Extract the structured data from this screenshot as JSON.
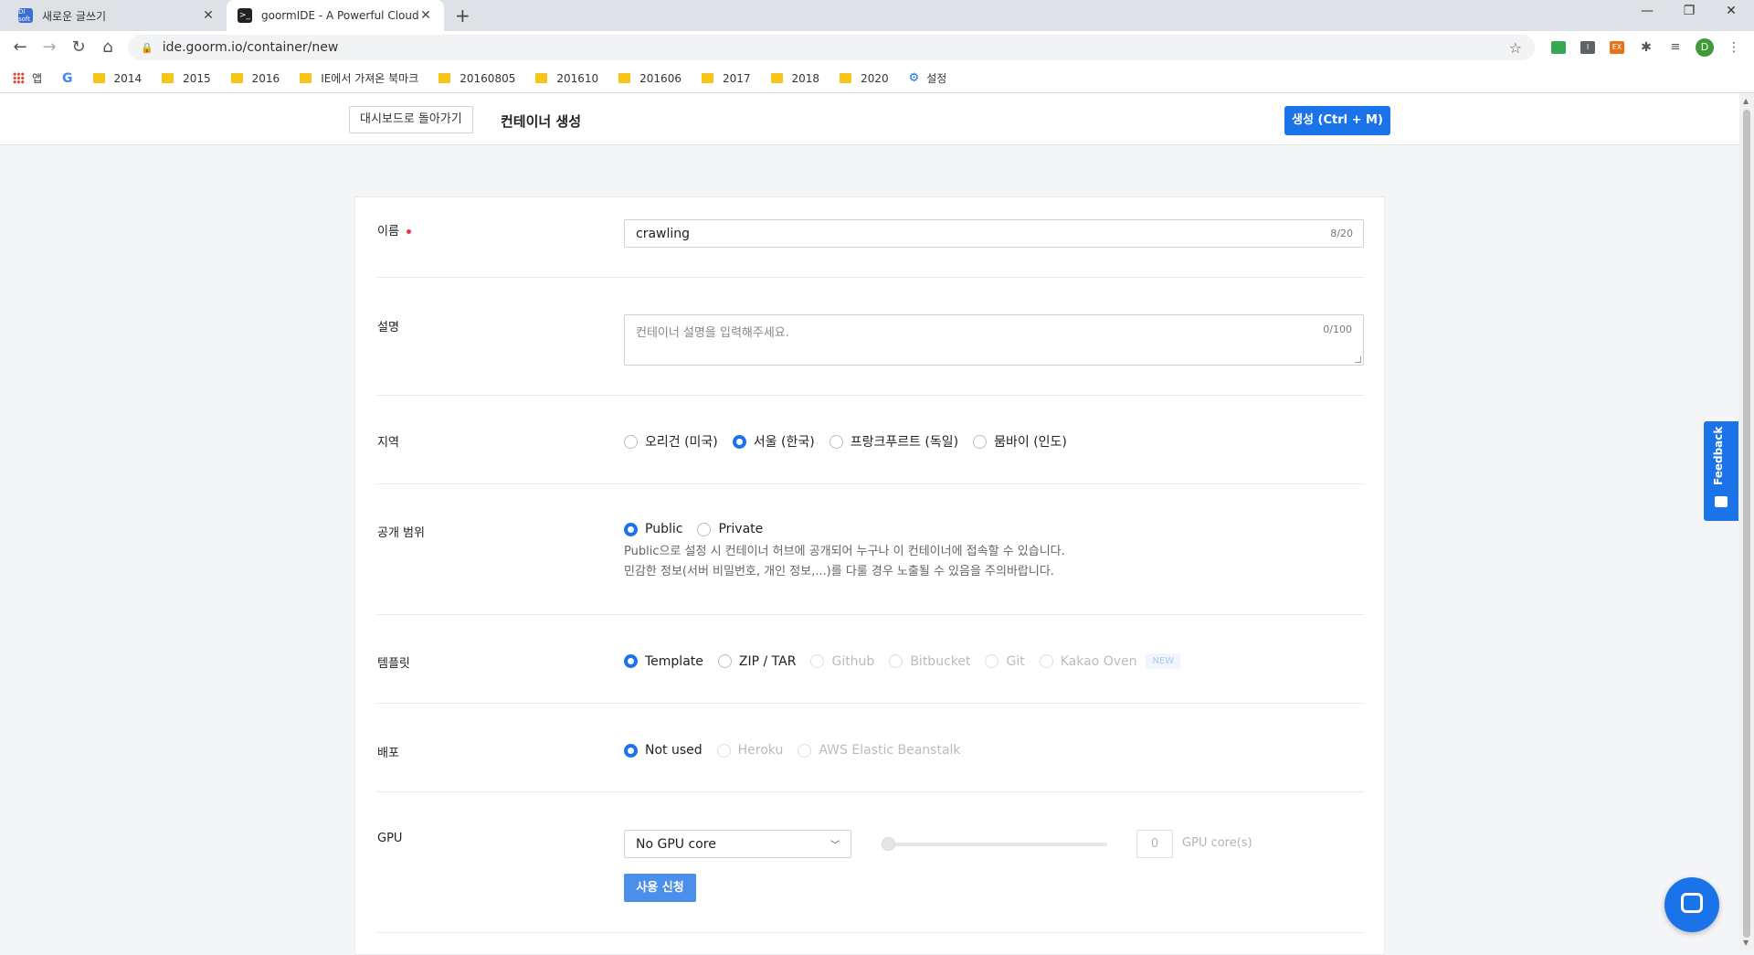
{
  "browser": {
    "tabs": [
      {
        "favicon": "DI soft",
        "title": "새로운 글쓰기"
      },
      {
        "favicon": ">_",
        "title": "goormIDE - A Powerful Cloud IDE"
      }
    ],
    "new_tab": "+",
    "window_controls": {
      "minimize": "—",
      "restore": "❐",
      "close": "✕"
    },
    "nav": {
      "back": "←",
      "forward": "→",
      "reload": "↻",
      "home": "⌂"
    },
    "url": "ide.goorm.io/container/new",
    "extensions": [
      {
        "name": "monitor-extension",
        "color": "#34a853",
        "text": ""
      },
      {
        "name": "i-extension",
        "color": "#5f6368",
        "text": "I"
      },
      {
        "name": "ex-extension",
        "color": "#e8711a",
        "text": "EX"
      }
    ],
    "profile_initial": "D",
    "profile_color": "#3f9b3a",
    "bookmarks": [
      {
        "type": "apps",
        "label": "앱"
      },
      {
        "type": "google",
        "label": "G"
      },
      {
        "type": "folder",
        "label": "2014"
      },
      {
        "type": "folder",
        "label": "2015"
      },
      {
        "type": "folder",
        "label": "2016"
      },
      {
        "type": "folder",
        "label": "IE에서 가져온 북마크"
      },
      {
        "type": "folder",
        "label": "20160805"
      },
      {
        "type": "folder",
        "label": "201610"
      },
      {
        "type": "folder",
        "label": "201606"
      },
      {
        "type": "folder",
        "label": "2017"
      },
      {
        "type": "folder",
        "label": "2018"
      },
      {
        "type": "folder",
        "label": "2020"
      },
      {
        "type": "settings",
        "label": "설정"
      }
    ]
  },
  "header": {
    "back_label": "대시보드로 돌아가기",
    "title": "컨테이너 생성",
    "create_label": "생성 (Ctrl + M)"
  },
  "form": {
    "name": {
      "label": "이름",
      "value": "crawling",
      "counter": "8/20"
    },
    "description": {
      "label": "설명",
      "placeholder": "컨테이너 설명을 입력해주세요.",
      "counter": "0/100"
    },
    "region": {
      "label": "지역",
      "options": [
        "오리건 (미국)",
        "서울 (한국)",
        "프랑크푸르트 (독일)",
        "뭄바이 (인도)"
      ],
      "selected": "서울 (한국)"
    },
    "visibility": {
      "label": "공개 범위",
      "options": [
        "Public",
        "Private"
      ],
      "selected": "Public",
      "help_line1": "Public으로 설정 시 컨테이너 허브에 공개되어 누구나 이 컨테이너에 접속할 수 있습니다.",
      "help_line2": "민감한 정보(서버 비밀번호, 개인 정보,...)를 다룰 경우 노출될 수 있음을 주의바랍니다."
    },
    "template": {
      "label": "템플릿",
      "options": [
        "Template",
        "ZIP / TAR",
        "Github",
        "Bitbucket",
        "Git",
        "Kakao Oven"
      ],
      "selected": "Template",
      "new_badge": "NEW"
    },
    "deploy": {
      "label": "배포",
      "options": [
        "Not used",
        "Heroku",
        "AWS Elastic Beanstalk"
      ],
      "selected": "Not used"
    },
    "gpu": {
      "label": "GPU",
      "select_value": "No GPU core",
      "count": "0",
      "unit": "GPU core(s)",
      "apply_label": "사용 신청"
    }
  },
  "feedback_label": "Feedback",
  "colors": {
    "accent": "#1a73e8",
    "required": "#e5394a"
  }
}
